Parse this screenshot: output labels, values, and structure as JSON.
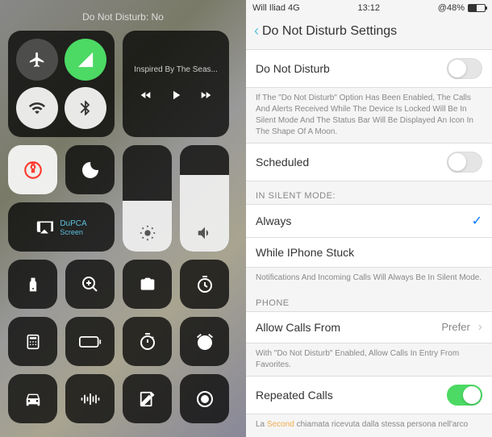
{
  "controlCenter": {
    "header": "Do Not Disturb: No",
    "musicTitle": "Inspired By The Seas...",
    "screenMirror": {
      "label": "DuPCA",
      "sublabel": "Screen"
    }
  },
  "settings": {
    "statusBar": {
      "carrier": "Will Iliad 4G",
      "time": "13:12",
      "battery": "48%"
    },
    "navTitle": "Do Not Disturb Settings",
    "dnd": {
      "label": "Do Not Disturb",
      "desc": "If The \"Do Not Disturb\" Option Has Been Enabled, The Calls And Alerts Received While The Device Is Locked Will Be In Silent Mode And The Status Bar Will Be Displayed An Icon In The Shape Of A Moon."
    },
    "scheduled": {
      "label": "Scheduled"
    },
    "silentHead": "IN SILENT MODE:",
    "always": "Always",
    "whileStuck": "While IPhone Stuck",
    "silentDesc": "Notifications And Incoming Calls Will Always Be In Silent Mode.",
    "phoneHead": "PHONE",
    "allowCalls": {
      "label": "Allow Calls From",
      "detail": "Prefer"
    },
    "allowDesc": "With \"Do Not Disturb\" Enabled, Allow Calls In Entry From Favorites.",
    "repeated": {
      "label": "Repeated Calls"
    },
    "repeatedDesc1": "La ",
    "repeatedHighlight": "Second",
    "repeatedDesc2": " chiamata ricevuta dalla stessa persona nell'arco"
  }
}
